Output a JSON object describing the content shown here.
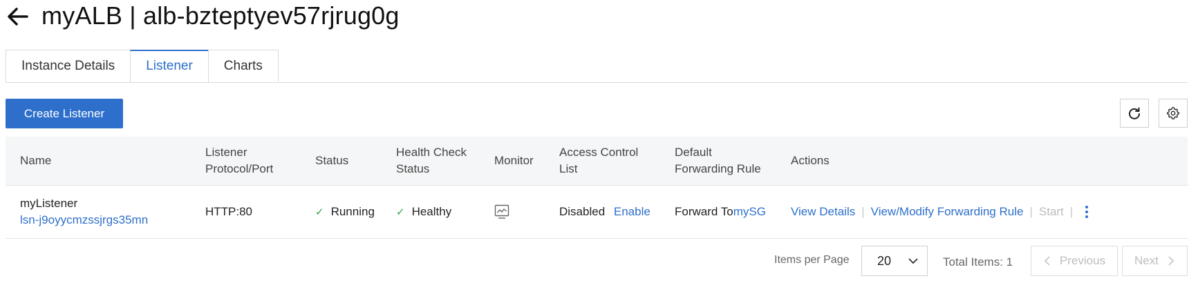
{
  "header": {
    "title": "myALB | alb-bzteptyev57rjrug0g"
  },
  "tabs": [
    {
      "label": "Instance Details",
      "active": false
    },
    {
      "label": "Listener",
      "active": true
    },
    {
      "label": "Charts",
      "active": false
    }
  ],
  "toolbar": {
    "create_label": "Create Listener",
    "refresh_icon": "refresh-icon",
    "settings_icon": "gear-icon"
  },
  "table": {
    "columns": {
      "name": "Name",
      "protocol_port": "Listener Protocol/Port",
      "status": "Status",
      "health_check": "Health Check Status",
      "monitor": "Monitor",
      "acl": "Access Control List",
      "default_rule": "Default Forwarding Rule",
      "actions": "Actions"
    },
    "rows": [
      {
        "name": "myListener",
        "id": "lsn-j9oyycmzssjrgs35mn",
        "protocol_port": "HTTP:80",
        "status": "Running",
        "health": "Healthy",
        "monitor_icon": "monitor-icon",
        "acl_status": "Disabled",
        "acl_action": "Enable",
        "rule_prefix": "Forward To",
        "rule_target": "mySG",
        "action_view": "View Details",
        "action_modify": "View/Modify Forwarding Rule",
        "action_start": "Start",
        "action_more_icon": "more-vertical-icon"
      }
    ]
  },
  "pagination": {
    "items_per_page_label": "Items per Page",
    "page_size": "20",
    "total": "Total Items: 1",
    "previous": "Previous",
    "next": "Next"
  },
  "colors": {
    "accent": "#2d6fcb",
    "success": "#2aa34a",
    "header_bg": "#f5f6f7"
  }
}
